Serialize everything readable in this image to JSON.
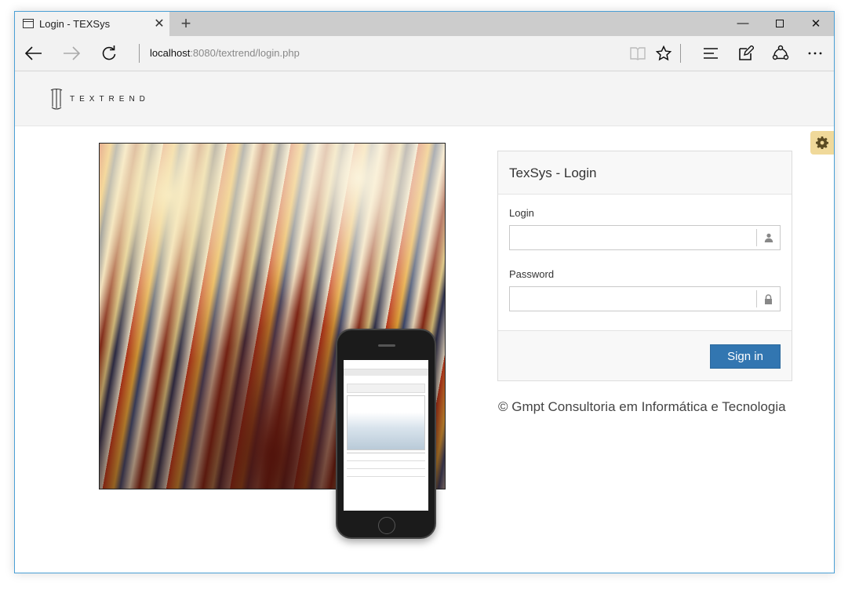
{
  "browser": {
    "tab_title": "Login - TEXSys",
    "new_tab_symbol": "+",
    "address_host": "localhost",
    "address_rest": ":8080/textrend/login.php"
  },
  "header": {
    "logo_text": "TEXTREND"
  },
  "login": {
    "title": "TexSys - Login",
    "login_label": "Login",
    "login_value": "",
    "password_label": "Password",
    "password_value": "",
    "submit_label": "Sign in"
  },
  "footer": {
    "copyright": "© Gmpt Consultoria em Informática e Tecnologia"
  },
  "colors": {
    "primary_button": "#3276b1",
    "settings_tab": "#f0d99a",
    "window_border": "#4a9fd5"
  }
}
